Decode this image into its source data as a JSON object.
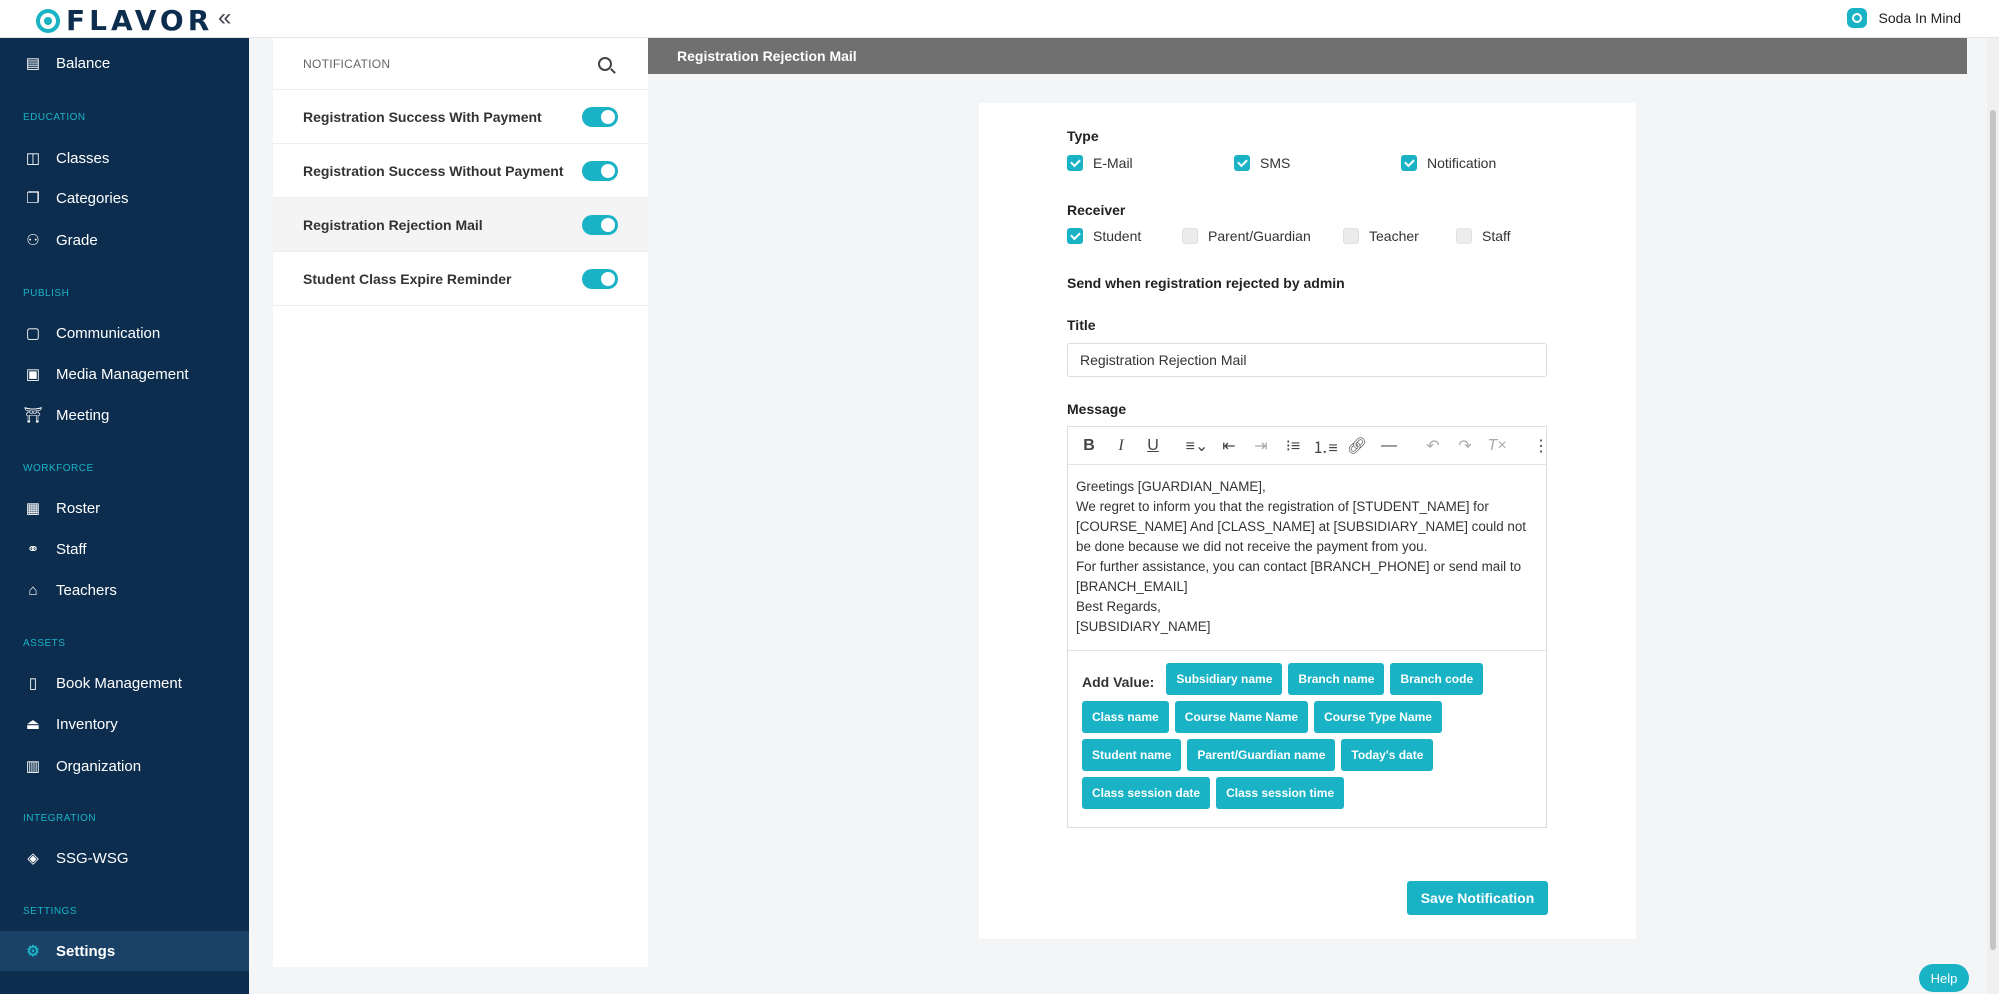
{
  "topbar": {
    "logo": "FLAVOR",
    "collapse_icon": "«",
    "org_name": "Soda In Mind"
  },
  "sidebar": {
    "items": [
      {
        "label": "Balance",
        "icon": "balance-icon"
      },
      {
        "section": "EDUCATION"
      },
      {
        "label": "Classes",
        "icon": "book-icon"
      },
      {
        "label": "Categories",
        "icon": "categories-icon"
      },
      {
        "label": "Grade",
        "icon": "grade-icon"
      },
      {
        "section": "PUBLISH"
      },
      {
        "label": "Communication",
        "icon": "chat-icon"
      },
      {
        "label": "Media Management",
        "icon": "media-icon"
      },
      {
        "label": "Meeting",
        "icon": "meeting-icon"
      },
      {
        "section": "WORKFORCE"
      },
      {
        "label": "Roster",
        "icon": "calendar-icon"
      },
      {
        "label": "Staff",
        "icon": "staff-icon"
      },
      {
        "label": "Teachers",
        "icon": "graduation-cap-icon"
      },
      {
        "section": "ASSETS"
      },
      {
        "label": "Book Management",
        "icon": "book-management-icon"
      },
      {
        "label": "Inventory",
        "icon": "inventory-icon"
      },
      {
        "label": "Organization",
        "icon": "building-icon"
      },
      {
        "section": "INTEGRATION"
      },
      {
        "label": "SSG-WSG",
        "icon": "layers-icon"
      },
      {
        "section": "SETTINGS"
      },
      {
        "label": "Settings",
        "icon": "gear-icon",
        "active": true
      }
    ]
  },
  "notifications": {
    "header": "NOTIFICATION",
    "items": [
      {
        "label": "Registration Success With Payment",
        "enabled": true
      },
      {
        "label": "Registration Success Without Payment",
        "enabled": true
      },
      {
        "label": "Registration Rejection Mail",
        "enabled": true,
        "active": true
      },
      {
        "label": "Student Class Expire Reminder",
        "enabled": true
      }
    ]
  },
  "detail": {
    "header": "Registration Rejection Mail",
    "type_label": "Type",
    "types": [
      {
        "label": "E-Mail",
        "checked": true
      },
      {
        "label": "SMS",
        "checked": true
      },
      {
        "label": "Notification",
        "checked": true
      }
    ],
    "receiver_label": "Receiver",
    "receivers": [
      {
        "label": "Student",
        "checked": true
      },
      {
        "label": "Parent/Guardian",
        "checked": false
      },
      {
        "label": "Teacher",
        "checked": false
      },
      {
        "label": "Staff",
        "checked": false
      }
    ],
    "trigger_text": "Send when registration rejected by admin",
    "title_label": "Title",
    "title_value": "Registration Rejection Mail",
    "message_label": "Message",
    "message_lines": [
      "Greetings [GUARDIAN_NAME],",
      "We regret to inform you that the registration of [STUDENT_NAME] for [COURSE_NAME] And [CLASS_NAME] at [SUBSIDIARY_NAME] could not be done because we did not receive the payment from you.",
      "For further assistance, you can contact [BRANCH_PHONE] or send mail to [BRANCH_EMAIL]",
      "Best Regards,",
      "[SUBSIDIARY_NAME]"
    ],
    "add_value_label": "Add Value:",
    "chips": [
      "Subsidiary name",
      "Branch name",
      "Branch code",
      "Class name",
      "Course Name Name",
      "Course Type Name",
      "Student name",
      "Parent/Guardian name",
      "Today's date",
      "Class session date",
      "Class session time"
    ],
    "save_label": "Save Notification"
  },
  "help_label": "Help",
  "colors": {
    "accent": "#1ab3c6",
    "sidebar": "#0c2d4e",
    "header_strip": "#707070"
  }
}
